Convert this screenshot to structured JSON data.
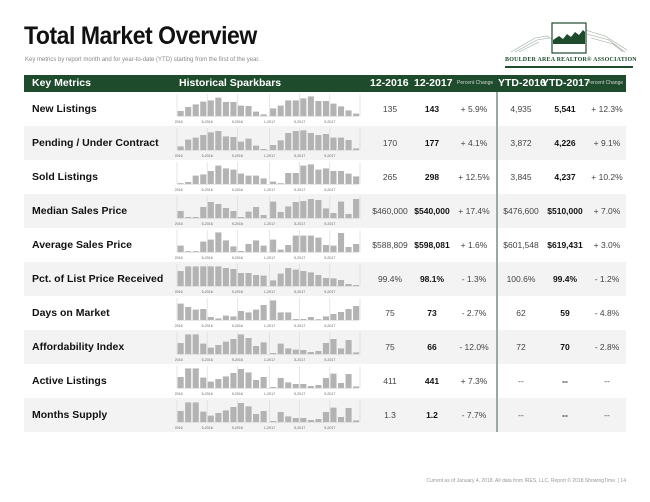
{
  "page": {
    "title": "Total Market Overview",
    "subtitle": "Key metrics by report month and for year-to-date (YTD) starting from the first of the year.",
    "logo_text": "BOULDER AREA REALTOR® ASSOCIATION",
    "footer": "Current as of January 4, 2018. All data from IRES, LLC. Report © 2018 ShowingTime.  |  14"
  },
  "colors": {
    "header_bg": "#1f4b2d",
    "bar": "#b3b3b3",
    "alt_row": "#f3f3f3",
    "divider": "#98aaa3"
  },
  "header": {
    "key_metrics": "Key Metrics",
    "sparkbars": "Historical Sparkbars",
    "col_12_2016": "12-2016",
    "col_12_2017": "12-2017",
    "pct_change": "Percent Change",
    "col_ytd_2016": "YTD-2016",
    "col_ytd_2017": "YTD-2017",
    "pct_change_ytd": "Percent Change"
  },
  "spark_axis_labels": [
    "1-2016",
    "5-2016",
    "9-2016",
    "1-2017",
    "5-2017",
    "9-2017"
  ],
  "rows": [
    {
      "label": "New Listings",
      "m2016": "135",
      "m2017": "143",
      "pct": "+ 5.9%",
      "y2016": "4,935",
      "y2017": "5,541",
      "ypct": "+ 12.3%",
      "bars": [
        0.25,
        0.45,
        0.58,
        0.72,
        0.78,
        0.92,
        0.7,
        0.7,
        0.52,
        0.5,
        0.22,
        0.08,
        0.38,
        0.52,
        0.78,
        0.78,
        0.88,
        0.98,
        0.75,
        0.75,
        0.62,
        0.48,
        0.28,
        0.12
      ]
    },
    {
      "label": "Pending / Under Contract",
      "m2016": "170",
      "m2017": "177",
      "pct": "+ 4.1%",
      "y2016": "3,872",
      "y2017": "4,226",
      "ypct": "+ 9.1%",
      "bars": [
        0.18,
        0.52,
        0.62,
        0.75,
        0.88,
        0.95,
        0.68,
        0.65,
        0.42,
        0.57,
        0.22,
        0.05,
        0.25,
        0.48,
        0.85,
        0.95,
        0.98,
        0.85,
        0.75,
        0.8,
        0.62,
        0.62,
        0.5,
        0.08
      ]
    },
    {
      "label": "Sold Listings",
      "m2016": "265",
      "m2017": "298",
      "pct": "+ 12.5%",
      "y2016": "3,845",
      "y2017": "4,237",
      "ypct": "+ 10.2%",
      "bars": [
        0.02,
        0.1,
        0.42,
        0.48,
        0.65,
        0.92,
        0.78,
        0.72,
        0.52,
        0.42,
        0.42,
        0.28,
        0.12,
        0.02,
        0.55,
        0.55,
        0.92,
        0.98,
        0.72,
        0.78,
        0.65,
        0.65,
        0.52,
        0.38
      ]
    },
    {
      "label": "Median Sales Price",
      "m2016": "$460,000",
      "m2017": "$540,000",
      "pct": "+ 17.4%",
      "y2016": "$476,600",
      "y2017": "$510,000",
      "ypct": "+ 7.0%",
      "bars": [
        0.35,
        0.05,
        0.05,
        0.55,
        0.8,
        0.7,
        0.5,
        0.35,
        0.05,
        0.32,
        0.55,
        0.15,
        0.82,
        0.3,
        0.58,
        0.8,
        0.85,
        0.95,
        0.9,
        0.48,
        0.25,
        0.82,
        0.2,
        0.95
      ]
    },
    {
      "label": "Average Sales Price",
      "m2016": "$588,809",
      "m2017": "$598,081",
      "pct": "+ 1.6%",
      "y2016": "$601,548",
      "y2017": "$619,431",
      "ypct": "+ 3.0%",
      "bars": [
        0.32,
        0.02,
        0.02,
        0.52,
        0.62,
        0.98,
        0.58,
        0.28,
        0.05,
        0.4,
        0.58,
        0.32,
        0.62,
        0.12,
        0.35,
        0.82,
        0.82,
        0.82,
        0.72,
        0.35,
        0.32,
        0.95,
        0.25,
        0.4
      ]
    },
    {
      "label": "Pct. of List Price Received",
      "m2016": "99.4%",
      "m2017": "98.1%",
      "pct": "- 1.3%",
      "y2016": "100.6%",
      "y2017": "99.4%",
      "ypct": "- 1.2%",
      "bars": [
        0.75,
        0.98,
        0.98,
        0.98,
        0.98,
        0.98,
        0.9,
        0.85,
        0.65,
        0.65,
        0.55,
        0.52,
        0.28,
        0.62,
        0.9,
        0.82,
        0.75,
        0.68,
        0.55,
        0.4,
        0.38,
        0.3,
        0.1,
        0.05
      ]
    },
    {
      "label": "Days on Market",
      "m2016": "75",
      "m2017": "73",
      "pct": "- 2.7%",
      "y2016": "62",
      "y2017": "59",
      "ypct": "- 4.8%",
      "bars": [
        0.82,
        0.65,
        0.52,
        0.55,
        0.15,
        0.08,
        0.22,
        0.18,
        0.45,
        0.38,
        0.52,
        0.75,
        0.98,
        0.38,
        0.38,
        0.05,
        0.05,
        0.15,
        0.02,
        0.18,
        0.3,
        0.4,
        0.55,
        0.7
      ]
    },
    {
      "label": "Affordability Index",
      "m2016": "75",
      "m2017": "66",
      "pct": "- 12.0%",
      "y2016": "72",
      "y2017": "70",
      "ypct": "- 2.8%",
      "bars": [
        0.55,
        0.98,
        0.98,
        0.52,
        0.32,
        0.45,
        0.62,
        0.75,
        0.98,
        0.8,
        0.4,
        0.58,
        0.05,
        0.52,
        0.28,
        0.22,
        0.2,
        0.1,
        0.15,
        0.55,
        0.75,
        0.28,
        0.7,
        0.08
      ]
    },
    {
      "label": "Active Listings",
      "m2016": "411",
      "m2017": "441",
      "pct": "+ 7.3%",
      "y2016": "--",
      "y2017": "--",
      "ypct": "--",
      "bars": [
        0.55,
        0.98,
        0.98,
        0.52,
        0.32,
        0.45,
        0.58,
        0.75,
        0.95,
        0.78,
        0.4,
        0.55,
        0.05,
        0.5,
        0.28,
        0.2,
        0.2,
        0.1,
        0.15,
        0.5,
        0.72,
        0.25,
        0.7,
        0.08
      ]
    },
    {
      "label": "Months Supply",
      "m2016": "1.3",
      "m2017": "1.2",
      "pct": "- 7.7%",
      "y2016": "--",
      "y2017": "--",
      "ypct": "--",
      "bars": [
        0.55,
        0.98,
        0.98,
        0.52,
        0.32,
        0.45,
        0.58,
        0.75,
        0.95,
        0.78,
        0.4,
        0.55,
        0.05,
        0.5,
        0.28,
        0.2,
        0.2,
        0.1,
        0.15,
        0.5,
        0.72,
        0.25,
        0.7,
        0.08
      ]
    }
  ]
}
